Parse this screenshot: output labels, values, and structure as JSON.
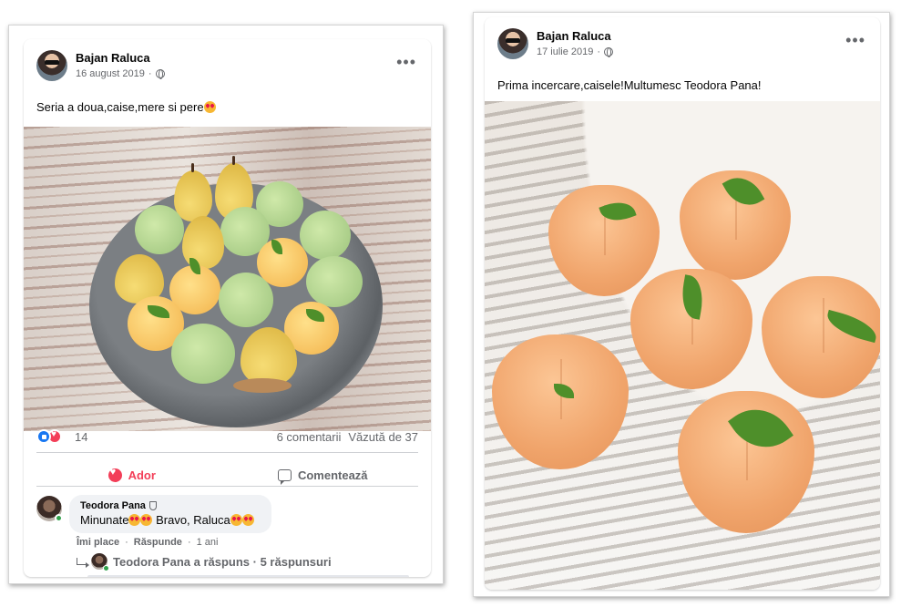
{
  "post_left": {
    "author": "Bajan Raluca",
    "date": "16 august 2019",
    "separator": "·",
    "caption": "Seria a doua,caise,mere si pere",
    "reactions_count": "14",
    "comments_count": "6 comentarii",
    "views": "Văzută de 37",
    "love_label": "Ador",
    "comment_label": "Comentează",
    "comment": {
      "author": "Teodora Pana",
      "text_part1": "Minunate",
      "text_part2": " Bravo, Raluca",
      "like_link": "Îmi place",
      "reply_link": "Răspunde",
      "dot": "·",
      "time": "1 ani",
      "replies": "Teodora Pana a răspuns · 5 răspunsuri"
    }
  },
  "post_right": {
    "author": "Bajan Raluca",
    "date": "17 iulie 2019",
    "separator": "·",
    "caption": "Prima incercare,caisele!Multumesc Teodora Pana!"
  },
  "icons": {
    "more": "more-options-icon",
    "privacy": "globe-icon",
    "like": "like-reaction-icon",
    "love": "love-reaction-icon",
    "comment": "comment-icon",
    "reply": "reply-arrow-icon",
    "emoji": "heart-eyes-emoji-icon"
  },
  "colors": {
    "love": "#f33e58",
    "like": "#1877f2",
    "secondary_text": "#65676b",
    "online": "#31a24c"
  }
}
